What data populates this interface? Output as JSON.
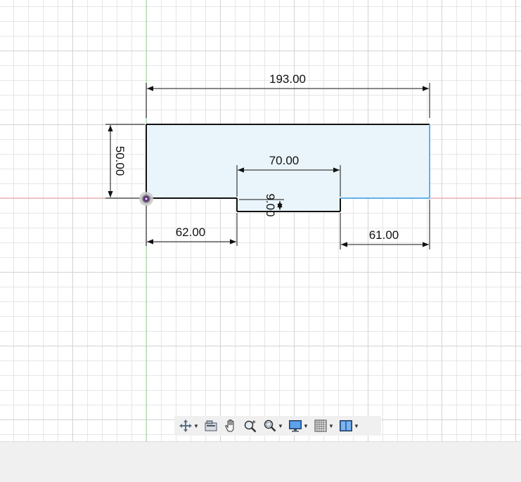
{
  "sketch": {
    "dimensions": {
      "total_width": "193.00",
      "height": "50.00",
      "slot_width": "70.00",
      "slot_depth": "9.00",
      "left_offset": "62.00",
      "right_offset": "61.00"
    }
  },
  "colors": {
    "grid": "#e6e6e6",
    "grid_major": "#d2d2d2",
    "x_axis": "#f3a0a0",
    "y_axis": "#9be09b",
    "profile_fill": "#eaf5fb",
    "profile_edge": "#111111",
    "profile_edge_selected": "#62b1e6",
    "toolbar_bg": "#f0f0f0",
    "status_bar_bg": "#f0f0f0"
  },
  "toolbar": {
    "items": [
      {
        "icon": "orbit-icon",
        "has_dropdown": true
      },
      {
        "icon": "look-at-icon",
        "has_dropdown": false
      },
      {
        "icon": "pan-hand-icon",
        "has_dropdown": false
      },
      {
        "icon": "zoom-icon",
        "has_dropdown": false
      },
      {
        "icon": "fit-zoom-icon",
        "has_dropdown": true
      },
      {
        "icon": "display-settings-icon",
        "has_dropdown": true
      },
      {
        "icon": "grid-settings-icon",
        "has_dropdown": true
      },
      {
        "icon": "viewports-icon",
        "has_dropdown": true
      }
    ]
  }
}
